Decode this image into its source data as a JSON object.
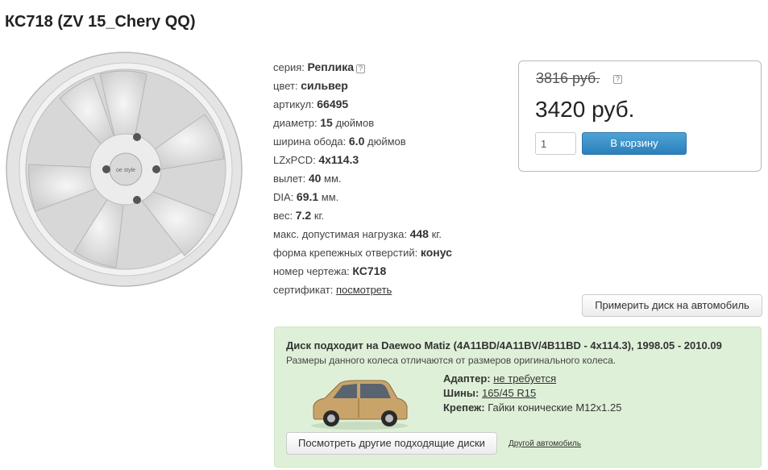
{
  "product": {
    "title": "КС718 (ZV 15_Chery QQ)"
  },
  "specs": {
    "series_label": "серия:",
    "series_value": "Реплика",
    "color_label": "цвет:",
    "color_value": "сильвер",
    "article_label": "артикул:",
    "article_value": "66495",
    "diameter_label": "диаметр:",
    "diameter_value": "15",
    "diameter_unit": "дюймов",
    "width_label": "ширина обода:",
    "width_value": "6.0",
    "width_unit": "дюймов",
    "pcd_label": "LZxPCD:",
    "pcd_value": "4x114.3",
    "offset_label": "вылет:",
    "offset_value": "40",
    "offset_unit": "мм.",
    "dia_label": "DIA:",
    "dia_value": "69.1",
    "dia_unit": "мм.",
    "weight_label": "вес:",
    "weight_value": "7.2",
    "weight_unit": "кг.",
    "load_label": "макс. допустимая нагрузка:",
    "load_value": "448",
    "load_unit": "кг.",
    "holes_label": "форма крепежных отверстий:",
    "holes_value": "конус",
    "drawing_label": "номер чертежа:",
    "drawing_value": "КС718",
    "cert_label": "сертификат:",
    "cert_link": "посмотреть"
  },
  "price": {
    "old": "3816 руб.",
    "new": "3420 руб.",
    "qty": "1",
    "cart_button": "В корзину"
  },
  "try_button": "Примерить диск на автомобиль",
  "fit": {
    "title": "Диск подходит на Daewoo Matiz (4A11BD/4A11BV/4B11BD - 4x114.3), 1998.05 - 2010.09",
    "note": "Размеры данного колеса отличаются от размеров оригинального колеса.",
    "adapter_label": "Адаптер:",
    "adapter_value": "не требуется",
    "tires_label": "Шины:",
    "tires_value": "165/45 R15",
    "fastener_label": "Крепеж:",
    "fastener_value": "Гайки конические М12x1.25",
    "other_discs_button": "Посмотреть другие подходящие диски",
    "other_car_link": "Другой автомобиль"
  },
  "icons": {
    "help": "question-icon",
    "wheel": "wheel-image",
    "car": "car-image"
  },
  "colors": {
    "accent": "#2b80bc",
    "fit_bg": "#dff0d8"
  }
}
